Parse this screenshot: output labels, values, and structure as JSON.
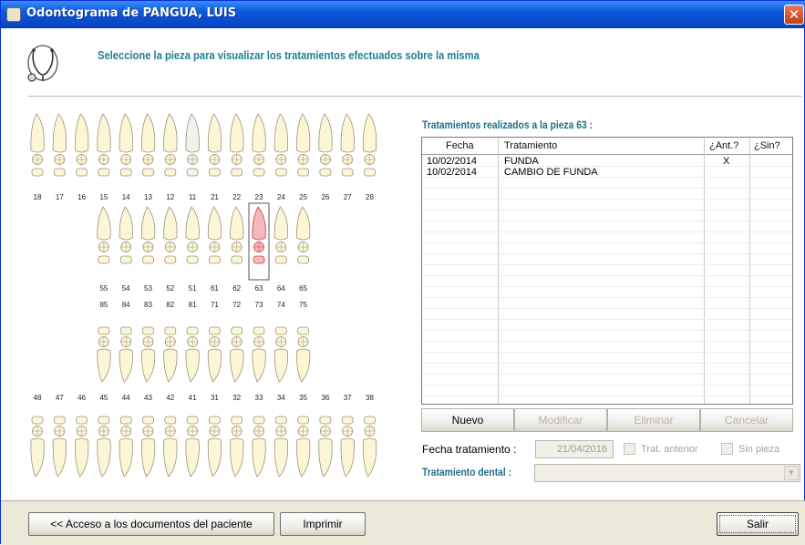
{
  "window": {
    "title": "Odontograma de PANGUA, LUIS",
    "close_symbol": "✕"
  },
  "header": {
    "icon": "stethoscope-icon",
    "instruction": "Seleccione la pieza para visualizar los tratamientos efectuados sobre la misma"
  },
  "odontogram": {
    "upper_permanent": [
      "18",
      "17",
      "16",
      "15",
      "14",
      "13",
      "12",
      "11",
      "21",
      "22",
      "23",
      "24",
      "25",
      "26",
      "27",
      "28"
    ],
    "upper_deciduous": [
      "55",
      "54",
      "53",
      "52",
      "51",
      "61",
      "62",
      "63",
      "64",
      "65"
    ],
    "lower_deciduous": [
      "85",
      "84",
      "83",
      "82",
      "81",
      "71",
      "72",
      "73",
      "74",
      "75"
    ],
    "lower_permanent": [
      "48",
      "47",
      "46",
      "45",
      "44",
      "43",
      "42",
      "41",
      "31",
      "32",
      "33",
      "34",
      "35",
      "36",
      "37",
      "38"
    ],
    "selected_tooth": "63",
    "colors": {
      "tooth_fill": "#fbf6d6",
      "tooth_stroke": "#9b9478",
      "selected_fill": "#f6b7bd",
      "selected_stroke": "#d23a47",
      "greyed_fill": "#f1f1ee"
    }
  },
  "treatments": {
    "title": "Tratamientos realizados a la pieza 63 :",
    "columns": [
      "Fecha",
      "Tratamiento",
      "¿Ant.?",
      "¿Sin?"
    ],
    "rows": [
      {
        "fecha": "10/02/2014",
        "tratamiento": "FUNDA",
        "ant": "X",
        "sin": ""
      },
      {
        "fecha": "10/02/2014",
        "tratamiento": "CAMBIO DE FUNDA",
        "ant": "",
        "sin": ""
      }
    ]
  },
  "buttons": {
    "nuevo": "Nuevo",
    "modificar": "Modificar",
    "eliminar": "Eliminar",
    "cancelar": "Cancelar"
  },
  "form": {
    "fecha_label": "Fecha tratamiento :",
    "fecha_value": "21/04/2016",
    "trat_anterior_label": "Trat. anterior",
    "sin_pieza_label": "Sin pieza",
    "dental_label": "Tratamiento dental :",
    "dental_value": ""
  },
  "footer": {
    "docs_button": "<< Acceso a los documentos del paciente",
    "imprimir_button": "Imprimir",
    "salir_button": "Salir"
  }
}
